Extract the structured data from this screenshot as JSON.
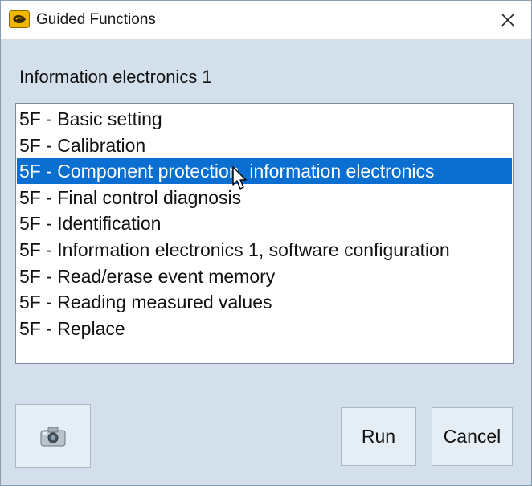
{
  "window": {
    "title": "Guided Functions",
    "close_glyph": "✕"
  },
  "group_label": "Information electronics 1",
  "functions": {
    "selected_index": 2,
    "items": [
      {
        "label": "5F - Basic setting"
      },
      {
        "label": "5F - Calibration"
      },
      {
        "label": "5F - Component protection, information electronics"
      },
      {
        "label": "5F - Final control diagnosis"
      },
      {
        "label": "5F - Identification"
      },
      {
        "label": "5F - Information electronics 1, software configuration"
      },
      {
        "label": "5F - Read/erase event memory"
      },
      {
        "label": "5F - Reading measured values"
      },
      {
        "label": "5F - Replace"
      }
    ]
  },
  "buttons": {
    "camera_icon": "camera-icon",
    "run": "Run",
    "cancel": "Cancel"
  },
  "colors": {
    "selection": "#0a6fd0",
    "window_background": "#d3e0ec",
    "title_icon": "#f2b600"
  }
}
